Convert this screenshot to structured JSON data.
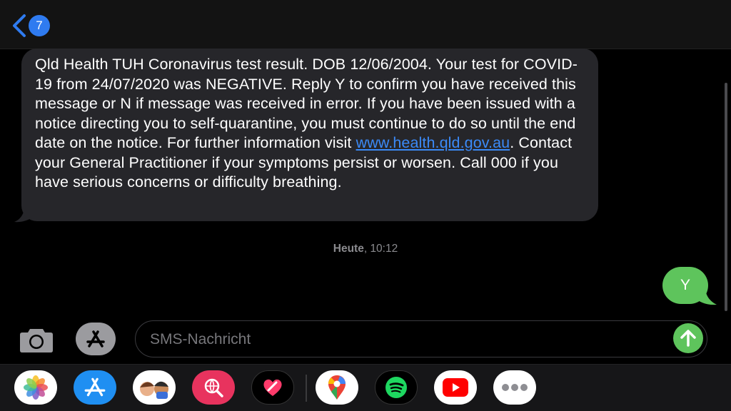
{
  "header": {
    "back_badge": "7"
  },
  "messages": {
    "incoming_pre_link": "Qld Health TUH Coronavirus test result. DOB 12/06/2004. Your test for COVID-19 from 24/07/2020 was NEGATIVE. Reply Y to confirm you have received this message or N if message was received in error. If you have been issued with a notice directing you to self-quarantine, you must continue to do so until the end date on the notice. For further information visit ",
    "incoming_link": "www.health.qld.gov.au",
    "incoming_post_link": ". Contact your General Practitioner if your symptoms persist or worsen. Call 000 if you have serious concerns or difficulty breathing.",
    "timestamp_day": "Heute",
    "timestamp_time": ", 10:12",
    "outgoing": "Y"
  },
  "composer": {
    "placeholder": "SMS-Nachricht"
  },
  "apps": [
    {
      "name": "photos-app-icon"
    },
    {
      "name": "app-store-app-icon"
    },
    {
      "name": "memoji-app-icon"
    },
    {
      "name": "search-web-app-icon"
    },
    {
      "name": "digital-touch-app-icon"
    },
    {
      "name": "google-maps-app-icon"
    },
    {
      "name": "spotify-app-icon"
    },
    {
      "name": "youtube-app-icon"
    },
    {
      "name": "more-apps-icon"
    }
  ],
  "colors": {
    "incoming_bubble": "#26262a",
    "outgoing_bubble": "#5ec45c",
    "link": "#3b8af7",
    "badge": "#2f7bf0"
  }
}
